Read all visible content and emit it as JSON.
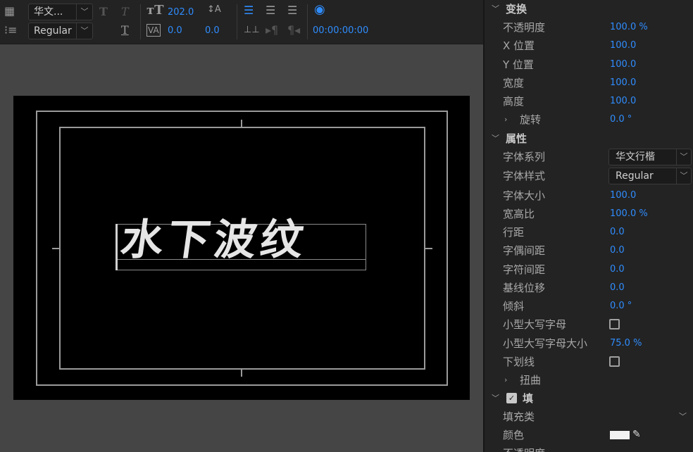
{
  "toolbar": {
    "font_family": "华文...",
    "font_style": "Regular",
    "font_size": "202.0",
    "tracking": "0.0",
    "kerning": "0.0",
    "timecode": "00:00:00:00"
  },
  "viewer": {
    "title_text": "水下波纹"
  },
  "panel": {
    "transform_section": "变换",
    "opacity_label": "不透明度",
    "opacity_value": "100.0 %",
    "x_label": "X 位置",
    "x_value": "100.0",
    "y_label": "Y 位置",
    "y_value": "100.0",
    "width_label": "宽度",
    "width_value": "100.0",
    "height_label": "高度",
    "height_value": "100.0",
    "rotation_label": "旋转",
    "rotation_value": "0.0 °",
    "properties_section": "属性",
    "font_family_label": "字体系列",
    "font_family_value": "华文行楷",
    "font_style_label": "字体样式",
    "font_style_value": "Regular",
    "font_size_label": "字体大小",
    "font_size_value": "100.0",
    "aspect_label": "宽高比",
    "aspect_value": "100.0 %",
    "leading_label": "行距",
    "leading_value": "0.0",
    "kerning_label": "字偶间距",
    "kerning_value": "0.0",
    "tracking_label": "字符间距",
    "tracking_value": "0.0",
    "baseline_label": "基线位移",
    "baseline_value": "0.0",
    "slant_label": "倾斜",
    "slant_value": "0.0 °",
    "small_caps_label": "小型大写字母",
    "small_caps_size_label": "小型大写字母大小",
    "small_caps_size_value": "75.0 %",
    "underline_label": "下划线",
    "distort_label": "扭曲",
    "fill_section": "填",
    "fill_type_label": "填充类",
    "color_label": "颜色",
    "opacity2_label": "不透明度"
  }
}
